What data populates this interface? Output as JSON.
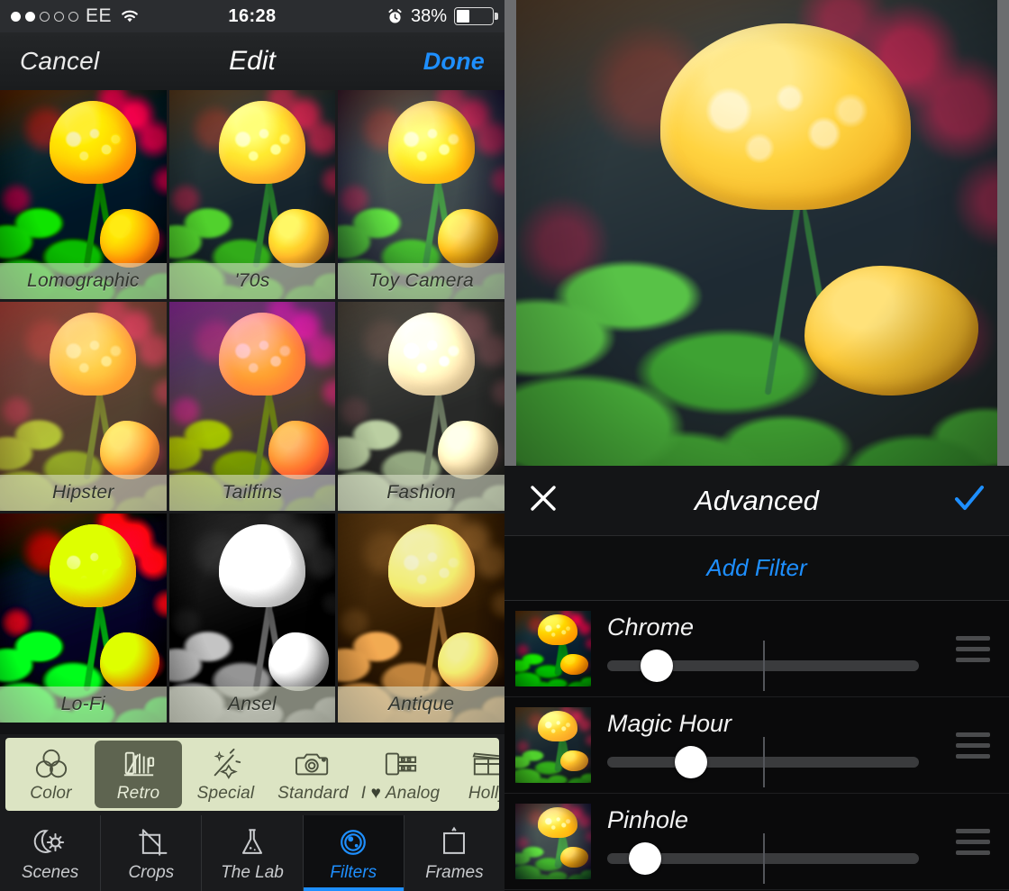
{
  "status_bar": {
    "signal_dots_filled": 2,
    "signal_dots_total": 5,
    "carrier": "EE",
    "wifi_icon": "wifi-icon",
    "time": "16:28",
    "alarm_icon": "alarm-clock-icon",
    "battery_percent": "38%",
    "battery_level": 38
  },
  "nav_bar": {
    "cancel_label": "Cancel",
    "title": "Edit",
    "done_label": "Done",
    "done_color": "#1e8fff"
  },
  "filter_grid": {
    "items": [
      {
        "name": "Lomographic",
        "style": "f-lomo"
      },
      {
        "name": "'70s",
        "style": "f-70s"
      },
      {
        "name": "Toy Camera",
        "style": "f-toy"
      },
      {
        "name": "Hipster",
        "style": "f-hip"
      },
      {
        "name": "Tailfins",
        "style": "f-tail"
      },
      {
        "name": "Fashion",
        "style": "f-fash"
      },
      {
        "name": "Lo-Fi",
        "style": "f-lofi"
      },
      {
        "name": "Ansel",
        "style": "f-ansel"
      },
      {
        "name": "Antique",
        "style": "f-anti"
      }
    ]
  },
  "category_strip": {
    "background": "#dce4c3",
    "selected_background": "#5e6450",
    "items": [
      {
        "label": "Color",
        "icon": "color-circles-icon",
        "selected": false
      },
      {
        "label": "Retro",
        "icon": "retro-film-icon",
        "selected": true
      },
      {
        "label": "Special",
        "icon": "magic-wand-icon",
        "selected": false
      },
      {
        "label": "Standard",
        "icon": "camera-icon",
        "selected": false
      },
      {
        "label": "I ♥ Analog",
        "icon": "film-roll-icon",
        "selected": false
      },
      {
        "label": "Holly",
        "icon": "clapperboard-icon",
        "selected": false
      }
    ]
  },
  "tab_bar": {
    "active_color": "#1e8fff",
    "items": [
      {
        "label": "Scenes",
        "icon": "moon-sun-icon",
        "active": false
      },
      {
        "label": "Crops",
        "icon": "crop-icon",
        "active": false
      },
      {
        "label": "The Lab",
        "icon": "flask-icon",
        "active": false
      },
      {
        "label": "Filters",
        "icon": "lens-icon",
        "active": true
      },
      {
        "label": "Frames",
        "icon": "frame-icon",
        "active": false
      }
    ]
  },
  "advanced_panel": {
    "close_icon": "close-x-icon",
    "title": "Advanced",
    "confirm_icon": "checkmark-icon",
    "confirm_color": "#1e8fff",
    "add_filter_label": "Add Filter",
    "add_filter_color": "#1e8fff",
    "filters": [
      {
        "name": "Chrome",
        "value": 16,
        "thumb_style": "f-chrome-sm",
        "handle_icon": "reorder-handle-icon"
      },
      {
        "name": "Magic Hour",
        "value": 27,
        "thumb_style": "f-70s",
        "handle_icon": "reorder-handle-icon"
      },
      {
        "name": "Pinhole",
        "value": 12,
        "thumb_style": "f-toy",
        "handle_icon": "reorder-handle-icon"
      }
    ],
    "slider_center_tick_percent": 50
  },
  "preview": {
    "subject": "yellow-poppy-photo"
  }
}
